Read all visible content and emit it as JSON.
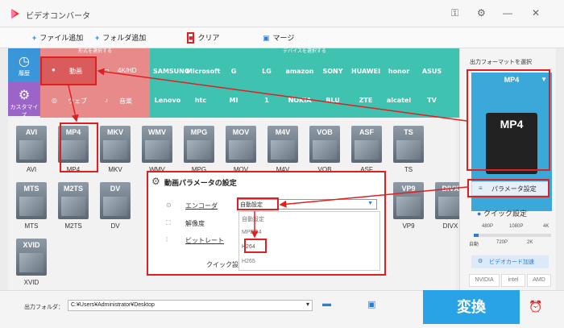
{
  "window": {
    "title": "ビデオコンバータ"
  },
  "toolbar": {
    "add_file": "ファイル追加",
    "add_folder": "フォルダ追加",
    "clear": "クリア",
    "merge": "マージ"
  },
  "nav": {
    "history": "履歴",
    "customize": "カスタマイズ"
  },
  "sections": {
    "by_format": "形式を選択する",
    "by_device": "デバイスを選択する"
  },
  "categories": {
    "video": "動画",
    "hd": "4K/HD",
    "web": "ウェブ",
    "audio": "音楽"
  },
  "brands": [
    "SAMSUNG",
    "Microsoft",
    "G",
    "LG",
    "amazon",
    "SONY",
    "HUAWEI",
    "honor",
    "ASUS",
    "Lenovo",
    "htc",
    "MI",
    "1",
    "NOKIA",
    "BLU",
    "ZTE",
    "alcatel",
    "TV"
  ],
  "formats_row1": [
    "AVI",
    "MP4",
    "MKV",
    "WMV",
    "MPG",
    "MOV",
    "M4V",
    "VOB",
    "ASF",
    "TS"
  ],
  "formats_row2": [
    "MTS",
    "M2TS",
    "DV",
    "VP9",
    "DIVX"
  ],
  "formats_row3": [
    "XVID"
  ],
  "right": {
    "output_label": "出力フォーマットを選択",
    "selected": "MP4",
    "param_btn": "パラメータ設定",
    "quick": "クイック設定",
    "low": "480P",
    "mid1": "1080P",
    "mid2": "4K",
    "auto": "自動",
    "p720": "720P",
    "k2": "2K",
    "gpu": "ビデオカード加速",
    "nvidia": "NVIDIA",
    "intel": "intel",
    "amd": "AMD"
  },
  "dialog": {
    "title": "動画パラメータの設定",
    "encoder": "エンコーダ",
    "resolution": "解像度",
    "bitrate": "ビットレート",
    "quick": "クイック設定",
    "selected": "自動設定",
    "options": [
      "自動設定",
      "MPEG4",
      "H264",
      "H265"
    ]
  },
  "bottom": {
    "output_folder": "出力フォルダ：",
    "path": "C:¥Users¥Administrator¥Desktop",
    "convert": "変換"
  }
}
